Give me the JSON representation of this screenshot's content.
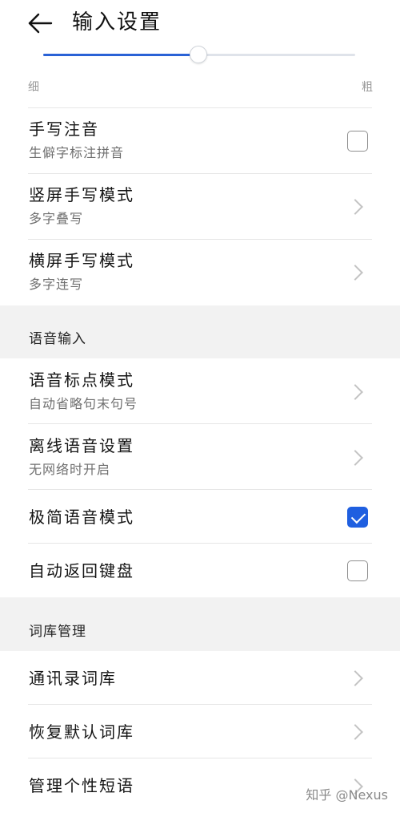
{
  "header": {
    "title": "输入设置",
    "back_icon": "arrow-left-icon"
  },
  "slider": {
    "min_label": "细",
    "max_label": "粗",
    "value_percent": 50,
    "accent": "#2a62d6"
  },
  "handwriting": {
    "items": [
      {
        "title": "手写注音",
        "subtitle": "生僻字标注拼音",
        "control": "checkbox",
        "checked": false
      },
      {
        "title": "竖屏手写模式",
        "subtitle": "多字叠写",
        "control": "chevron"
      },
      {
        "title": "横屏手写模式",
        "subtitle": "多字连写",
        "control": "chevron"
      }
    ]
  },
  "voice": {
    "section_title": "语音输入",
    "items": [
      {
        "title": "语音标点模式",
        "subtitle": "自动省略句末句号",
        "control": "chevron"
      },
      {
        "title": "离线语音设置",
        "subtitle": "无网络时开启",
        "control": "chevron"
      },
      {
        "title": "极简语音模式",
        "control": "checkbox",
        "checked": true
      },
      {
        "title": "自动返回键盘",
        "control": "checkbox",
        "checked": false
      }
    ]
  },
  "lexicon": {
    "section_title": "词库管理",
    "items": [
      {
        "title": "通讯录词库",
        "control": "chevron"
      },
      {
        "title": "恢复默认词库",
        "control": "chevron"
      },
      {
        "title": "管理个性短语",
        "control": "chevron"
      }
    ]
  },
  "watermark": "知乎 @Nexus",
  "colors": {
    "accent": "#1f5fe0",
    "section_bg": "#f2f2f2"
  }
}
